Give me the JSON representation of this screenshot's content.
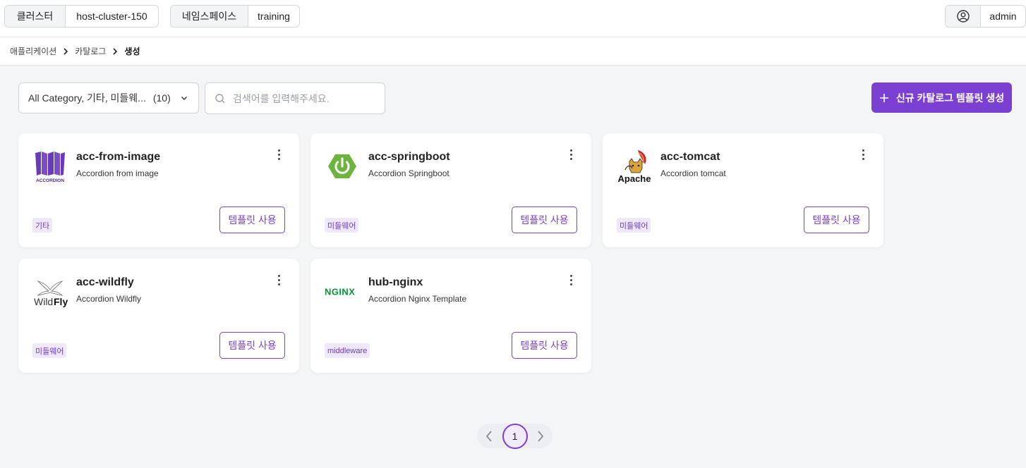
{
  "topbar": {
    "cluster": {
      "label": "클러스터",
      "value": "host-cluster-150"
    },
    "namespace": {
      "label": "네임스페이스",
      "value": "training"
    },
    "user": {
      "name": "admin"
    }
  },
  "breadcrumb": [
    "애플리케이션",
    "카탈로그",
    "생성"
  ],
  "filter": {
    "label": "All Category, 기타, 미들웨...",
    "count": "(10)"
  },
  "search": {
    "placeholder": "검색어를 입력해주세요."
  },
  "new_button": {
    "label": "신규 카탈로그 템플릿 생성"
  },
  "cards": [
    {
      "name": "acc-from-image",
      "desc": "Accordion from image",
      "tag": "기타",
      "button": "템플릿 사용",
      "logo": "accordion-logo",
      "logo_text": "ACCORDION"
    },
    {
      "name": "acc-springboot",
      "desc": "Accordion Springboot",
      "tag": "미들웨어",
      "button": "템플릿 사용",
      "logo": "springboot-logo"
    },
    {
      "name": "acc-tomcat",
      "desc": "Accordion tomcat",
      "tag": "미들웨어",
      "button": "템플릿 사용",
      "logo": "apache-tomcat-logo",
      "logo_text": "Apache"
    },
    {
      "name": "acc-wildfly",
      "desc": "Accordion Wildfly",
      "tag": "미들웨어",
      "button": "템플릿 사용",
      "logo": "wildfly-logo",
      "logo_text_a": "Wild",
      "logo_text_b": "Fly"
    },
    {
      "name": "hub-nginx",
      "desc": "Accordion Nginx Template",
      "tag": "middleware",
      "button": "템플릿 사용",
      "logo": "nginx-logo",
      "logo_text": "NGINX"
    }
  ],
  "pagination": {
    "current": "1"
  },
  "colors": {
    "accent": "#7b3fd1",
    "tag_bg": "#efe8fb",
    "springboot": "#6db33f",
    "nginx": "#009639"
  }
}
